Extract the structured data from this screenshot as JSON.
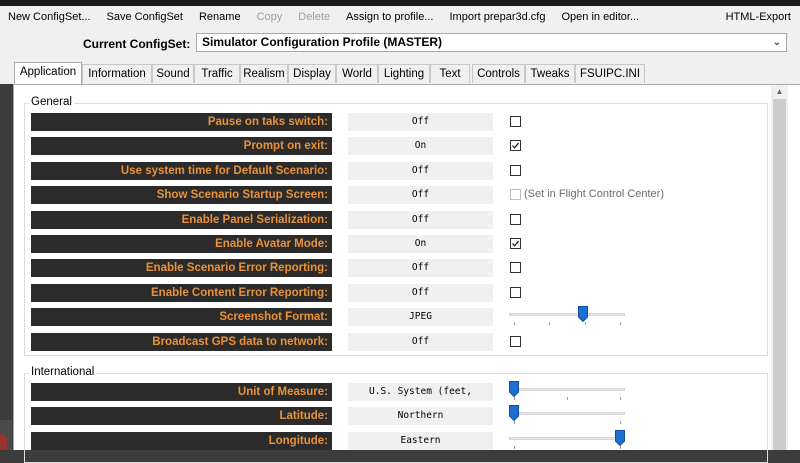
{
  "toolbar": {
    "items": [
      {
        "label": "New ConfigSet...",
        "enabled": true
      },
      {
        "label": "Save ConfigSet",
        "enabled": true
      },
      {
        "label": "Rename",
        "enabled": true
      },
      {
        "label": "Copy",
        "enabled": false
      },
      {
        "label": "Delete",
        "enabled": false
      },
      {
        "label": "Assign to profile...",
        "enabled": true
      },
      {
        "label": "Import prepar3d.cfg",
        "enabled": true
      },
      {
        "label": "Open in editor...",
        "enabled": true
      }
    ],
    "right_label": "HTML-Export"
  },
  "configset": {
    "label": "Current ConfigSet:",
    "value": "Simulator Configuration Profile (MASTER)"
  },
  "tabs": [
    {
      "label": "Application",
      "active": true
    },
    {
      "label": "Information",
      "active": false
    },
    {
      "label": "Sound",
      "active": false
    },
    {
      "label": "Traffic",
      "active": false
    },
    {
      "label": "Realism",
      "active": false
    },
    {
      "label": "Display",
      "active": false
    },
    {
      "label": "World",
      "active": false
    },
    {
      "label": "Lighting",
      "active": false
    },
    {
      "label": "Text",
      "active": false
    },
    {
      "label": "Controls",
      "active": false
    },
    {
      "label": "Tweaks",
      "active": false
    },
    {
      "label": "FSUIPC.INI",
      "active": false
    }
  ],
  "groups": {
    "general": {
      "title": "General",
      "rows": [
        {
          "label": "Pause on taks switch:",
          "value": "Off",
          "control": "checkbox",
          "checked": false
        },
        {
          "label": "Prompt on exit:",
          "value": "On",
          "control": "checkbox",
          "checked": true
        },
        {
          "label": "Use system time for Default Scenario:",
          "value": "Off",
          "control": "checkbox",
          "checked": false
        },
        {
          "label": "Show Scenario Startup Screen:",
          "value": "Off",
          "control": "checkbox",
          "checked": false,
          "disabled": true,
          "note": "(Set in Flight Control Center)"
        },
        {
          "label": "Enable Panel Serialization:",
          "value": "Off",
          "control": "checkbox",
          "checked": false
        },
        {
          "label": "Enable Avatar Mode:",
          "value": "On",
          "control": "checkbox",
          "checked": true
        },
        {
          "label": "Enable Scenario Error Reporting:",
          "value": "Off",
          "control": "checkbox",
          "checked": false
        },
        {
          "label": "Enable Content Error Reporting:",
          "value": "Off",
          "control": "checkbox",
          "checked": false
        },
        {
          "label": "Screenshot Format:",
          "value": "JPEG",
          "control": "slider",
          "level": 0.65,
          "ticks": 4
        },
        {
          "label": "Broadcast GPS data to network:",
          "value": "Off",
          "control": "checkbox",
          "checked": false
        }
      ]
    },
    "international": {
      "title": "International",
      "rows": [
        {
          "label": "Unit of Measure:",
          "value": "U.S. System (feet,",
          "control": "slider",
          "level": 0.0,
          "ticks": 3
        },
        {
          "label": "Latitude:",
          "value": "Northern",
          "control": "slider",
          "level": 0.0,
          "ticks": 2
        },
        {
          "label": "Longitude:",
          "value": "Eastern",
          "control": "slider",
          "level": 1.0,
          "ticks": 2
        }
      ]
    }
  },
  "colors": {
    "label_bg": "#2b2b2b",
    "label_text": "#e8923a",
    "slider_thumb": "#1e6fd0"
  }
}
